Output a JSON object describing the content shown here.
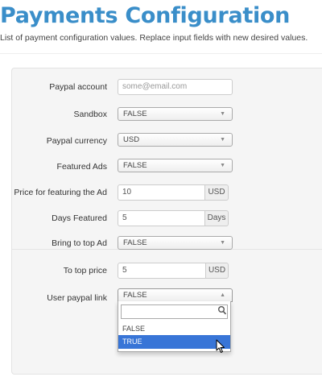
{
  "page": {
    "title": "Payments Configuration",
    "description": "List of payment configuration values. Replace input fields with new desired values."
  },
  "form": {
    "paypal_account": {
      "label": "Paypal account",
      "value": "",
      "placeholder": "some@email.com"
    },
    "sandbox": {
      "label": "Sandbox",
      "value": "FALSE"
    },
    "paypal_currency": {
      "label": "Paypal currency",
      "value": "USD"
    },
    "featured_ads": {
      "label": "Featured Ads",
      "value": "FALSE"
    },
    "featuring_price": {
      "label": "Price for featuring the Ad",
      "value": "10",
      "addon": "USD"
    },
    "days_featured": {
      "label": "Days Featured",
      "value": "5",
      "addon": "Days"
    },
    "bring_to_top": {
      "label": "Bring to top Ad",
      "value": "FALSE"
    },
    "to_top_price": {
      "label": "To top price",
      "value": "5",
      "addon": "USD"
    },
    "user_paypal_link": {
      "label": "User paypal link",
      "value": "FALSE",
      "open": true,
      "search_value": "",
      "options": [
        "FALSE",
        "TRUE"
      ],
      "highlighted": "TRUE"
    }
  },
  "icons": {
    "select_arrow": "chevron-down-icon",
    "select_arrow_open": "chevron-up-icon",
    "search": "search-icon",
    "cursor": "mouse-pointer-icon"
  },
  "colors": {
    "title": "#3a8ec9",
    "highlight": "#3875d7"
  }
}
